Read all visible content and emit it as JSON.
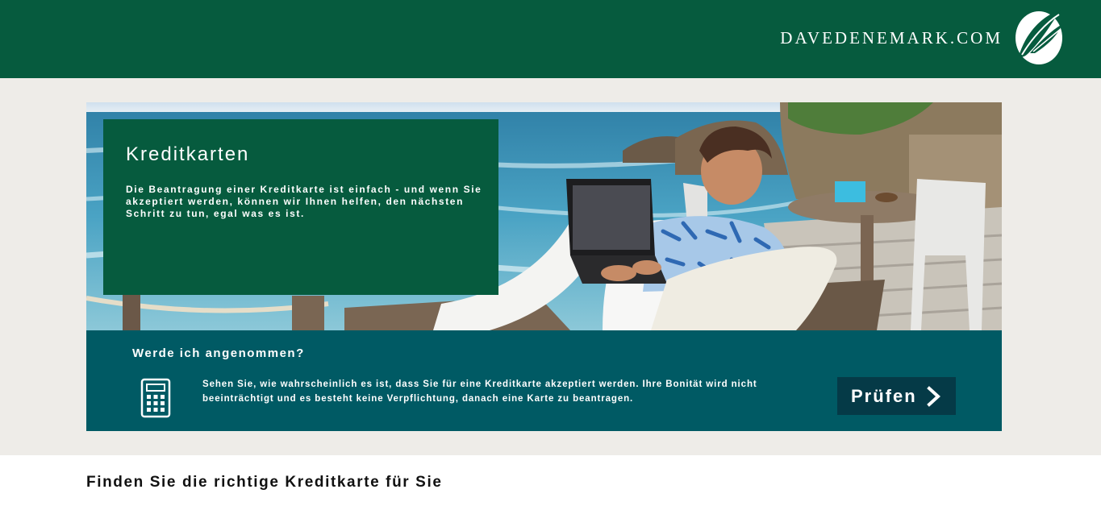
{
  "header": {
    "brand": "DAVEDENEMARK.COM",
    "logo_icon": "feather-globe-icon",
    "background": "#065b3e"
  },
  "hero": {
    "image": "man-with-laptop-on-beach-terrace",
    "title": "Kreditkarten",
    "text": "Die Beantragung einer Kreditkarte ist einfach - und wenn Sie akzeptiert werden, können wir Ihnen helfen, den nächsten Schritt zu tun, egal was es ist.",
    "box_color": "#065b3e"
  },
  "eligibility": {
    "title": "Werde ich angenommen?",
    "icon": "calculator-icon",
    "text": "Sehen Sie, wie wahrscheinlich es ist, dass Sie für eine Kreditkarte akzeptiert werden. Ihre Bonität wird nicht beeinträchtigt und es besteht keine Verpflichtung, danach eine Karte zu beantragen.",
    "button_label": "Prüfen",
    "button_icon": "chevron-right-icon",
    "bar_color": "#005a64",
    "button_color": "#053a47"
  },
  "main": {
    "section_title": "Finden Sie die richtige Kreditkarte für Sie"
  }
}
